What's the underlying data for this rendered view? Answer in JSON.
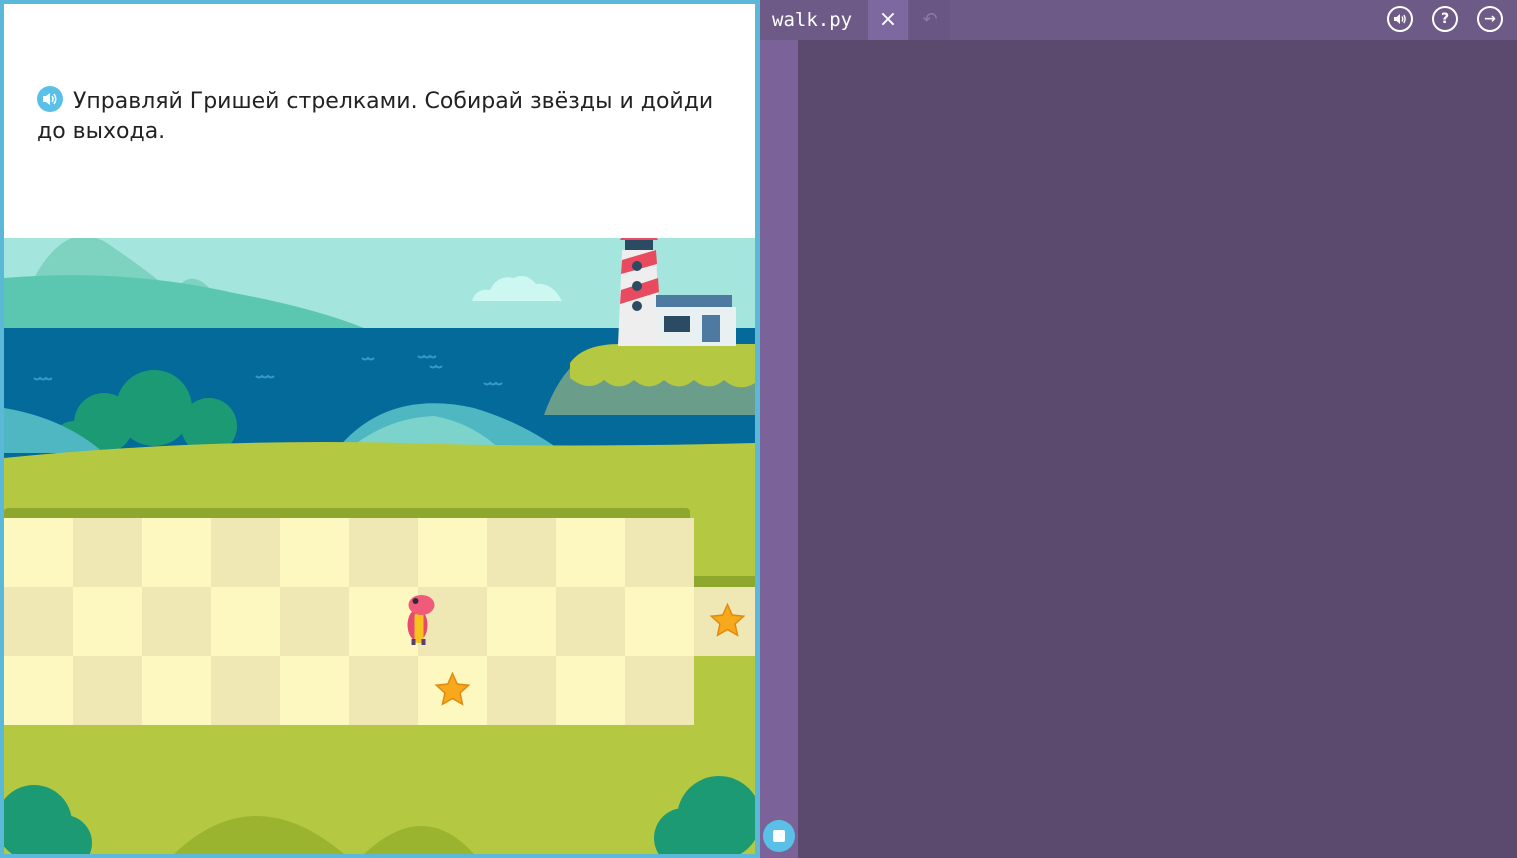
{
  "instruction": {
    "text": "Управляй Гришей стрелками. Собирай звёзды и дойди до выхода."
  },
  "editor": {
    "file_tab": "walk.py",
    "close_glyph": "×",
    "undo_glyph": "↶",
    "icons": [
      "sound-icon",
      "help-icon",
      "exit-icon"
    ],
    "help_glyph": "?",
    "exit_glyph": "→"
  },
  "game": {
    "grid_columns": 10,
    "grid_rows": 3,
    "character_cell": [
      6,
      1
    ],
    "stars": [
      [
        10,
        1
      ],
      [
        6,
        2
      ]
    ],
    "scenery": [
      "lighthouse",
      "house",
      "sea",
      "mountains",
      "bushes",
      "cloud"
    ]
  },
  "colors": {
    "accent": "#5bc0e8",
    "editor_bg": "#5b4a6e",
    "gutter": "#7b6399",
    "tabbar": "#6e5a86",
    "grass": "#b5c842",
    "sea": "#036a9a",
    "star": "#f7a81b"
  }
}
